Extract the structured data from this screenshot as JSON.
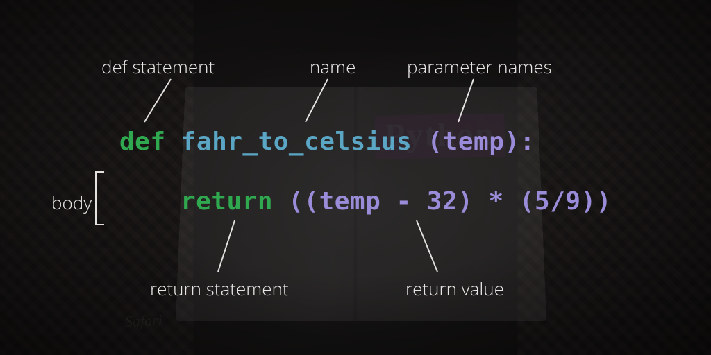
{
  "labels": {
    "def_statement": "def statement",
    "name": "name",
    "parameter_names": "parameter names",
    "body": "body",
    "return_statement": "return statement",
    "return_value": "return value"
  },
  "code": {
    "line1": {
      "keyword_def": "def",
      "function_name": "fahr_to_celsius",
      "params": "(temp):"
    },
    "line2": {
      "keyword_return": "return",
      "expression": "((temp - 32) * (5/9))"
    }
  },
  "background": {
    "book_title": "Python",
    "publisher_mark": "Safari"
  }
}
